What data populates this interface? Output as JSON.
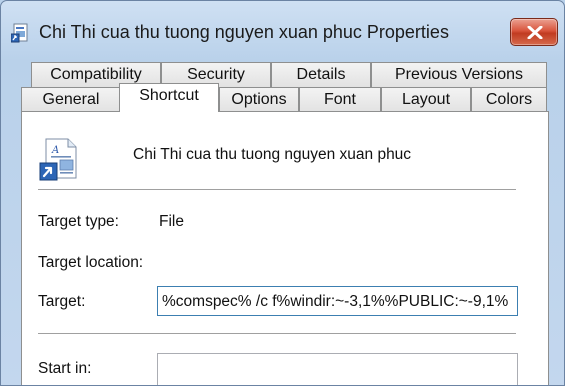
{
  "window": {
    "title": "Chi Thi cua thu tuong nguyen xuan phuc Properties"
  },
  "tabs_row1": [
    {
      "label": "Compatibility"
    },
    {
      "label": "Security"
    },
    {
      "label": "Details"
    },
    {
      "label": "Previous Versions"
    }
  ],
  "tabs_row2": [
    {
      "label": "General"
    },
    {
      "label": "Shortcut",
      "active": true
    },
    {
      "label": "Options"
    },
    {
      "label": "Font"
    },
    {
      "label": "Layout"
    },
    {
      "label": "Colors"
    }
  ],
  "shortcut": {
    "file_name": "Chi Thi cua thu tuong nguyen xuan phuc",
    "target_type_label": "Target type:",
    "target_type_value": "File",
    "target_location_label": "Target location:",
    "target_label": "Target:",
    "target_value": "%comspec% /c f%windir:~-3,1%%PUBLIC:~-9,1%",
    "start_in_label": "Start in:",
    "start_in_value": ""
  },
  "colors": {
    "accent": "#3c7fb1",
    "close_button": "#c13b21"
  }
}
